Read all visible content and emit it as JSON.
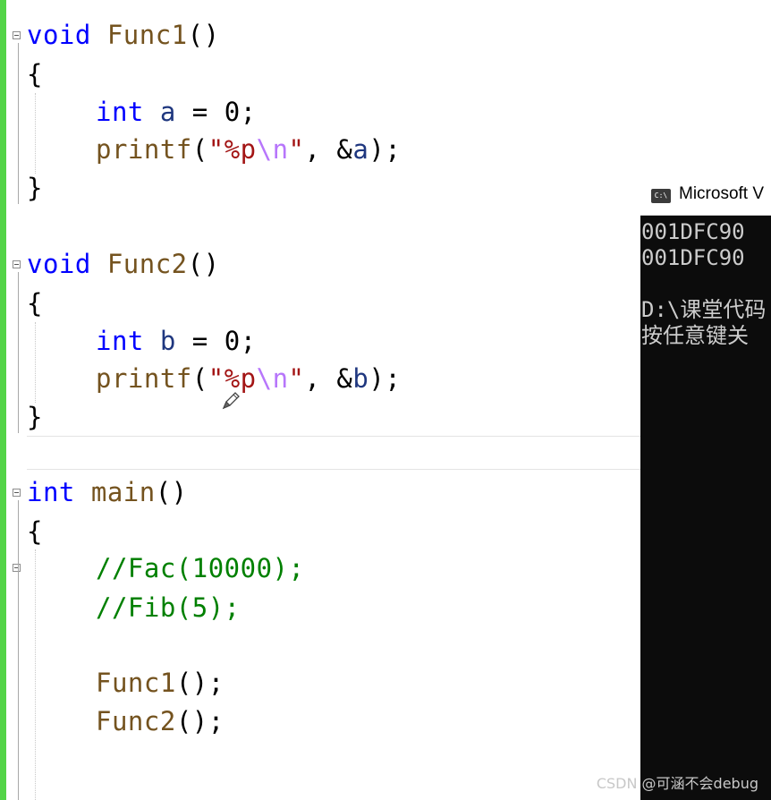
{
  "editor": {
    "lines": [
      {
        "segments": [
          {
            "text": "void",
            "kind": "kw"
          },
          {
            "text": " "
          },
          {
            "text": "Func1",
            "kind": "fn"
          },
          {
            "text": "()"
          }
        ]
      },
      {
        "segments": [
          {
            "text": "{"
          }
        ]
      },
      {
        "segments": [
          {
            "text": "int",
            "kind": "kw"
          },
          {
            "text": " "
          },
          {
            "text": "a",
            "kind": "var"
          },
          {
            "text": " = 0;"
          }
        ]
      },
      {
        "segments": [
          {
            "text": "printf",
            "kind": "fn"
          },
          {
            "text": "("
          },
          {
            "text": "\"%p",
            "kind": "str"
          },
          {
            "text": "\\n",
            "kind": "esc"
          },
          {
            "text": "\"",
            "kind": "str"
          },
          {
            "text": ", &"
          },
          {
            "text": "a",
            "kind": "var"
          },
          {
            "text": ");"
          }
        ]
      },
      {
        "segments": [
          {
            "text": "}"
          }
        ]
      },
      {
        "segments": [
          {
            "text": "void",
            "kind": "kw"
          },
          {
            "text": " "
          },
          {
            "text": "Func2",
            "kind": "fn"
          },
          {
            "text": "()"
          }
        ]
      },
      {
        "segments": [
          {
            "text": "{"
          }
        ]
      },
      {
        "segments": [
          {
            "text": "int",
            "kind": "kw"
          },
          {
            "text": " "
          },
          {
            "text": "b",
            "kind": "var"
          },
          {
            "text": " = 0;"
          }
        ]
      },
      {
        "segments": [
          {
            "text": "printf",
            "kind": "fn"
          },
          {
            "text": "("
          },
          {
            "text": "\"%p",
            "kind": "str"
          },
          {
            "text": "\\n",
            "kind": "esc"
          },
          {
            "text": "\"",
            "kind": "str"
          },
          {
            "text": ", &"
          },
          {
            "text": "b",
            "kind": "var"
          },
          {
            "text": ");"
          }
        ]
      },
      {
        "segments": [
          {
            "text": "}"
          }
        ]
      },
      {
        "segments": [
          {
            "text": "int",
            "kind": "kw"
          },
          {
            "text": " "
          },
          {
            "text": "main",
            "kind": "fn"
          },
          {
            "text": "()"
          }
        ]
      },
      {
        "segments": [
          {
            "text": "{"
          }
        ]
      },
      {
        "segments": [
          {
            "text": "//Fac(10000);",
            "kind": "cmt"
          }
        ]
      },
      {
        "segments": [
          {
            "text": "//Fib(5);",
            "kind": "cmt"
          }
        ]
      },
      {
        "segments": [
          {
            "text": "Func1",
            "kind": "fn"
          },
          {
            "text": "();"
          }
        ]
      },
      {
        "segments": [
          {
            "text": "Func2",
            "kind": "fn"
          },
          {
            "text": "();"
          }
        ]
      }
    ]
  },
  "console": {
    "title": "Microsoft V",
    "icon_label": "C:\\",
    "lines": [
      "001DFC90",
      "001DFC90",
      "",
      "D:\\课堂代码",
      "按任意键关"
    ]
  },
  "watermark": "CSDN @可涵不会debug",
  "colors": {
    "keyword": "#0000ff",
    "function": "#74531f",
    "variable": "#1f377f",
    "string": "#a31515",
    "escape": "#b776fb",
    "comment": "#008000",
    "change_bar": "#53d447",
    "console_bg": "#0c0c0c"
  },
  "icons": [
    "fold-collapse-icon",
    "pencil-cursor-icon",
    "console-app-icon"
  ]
}
